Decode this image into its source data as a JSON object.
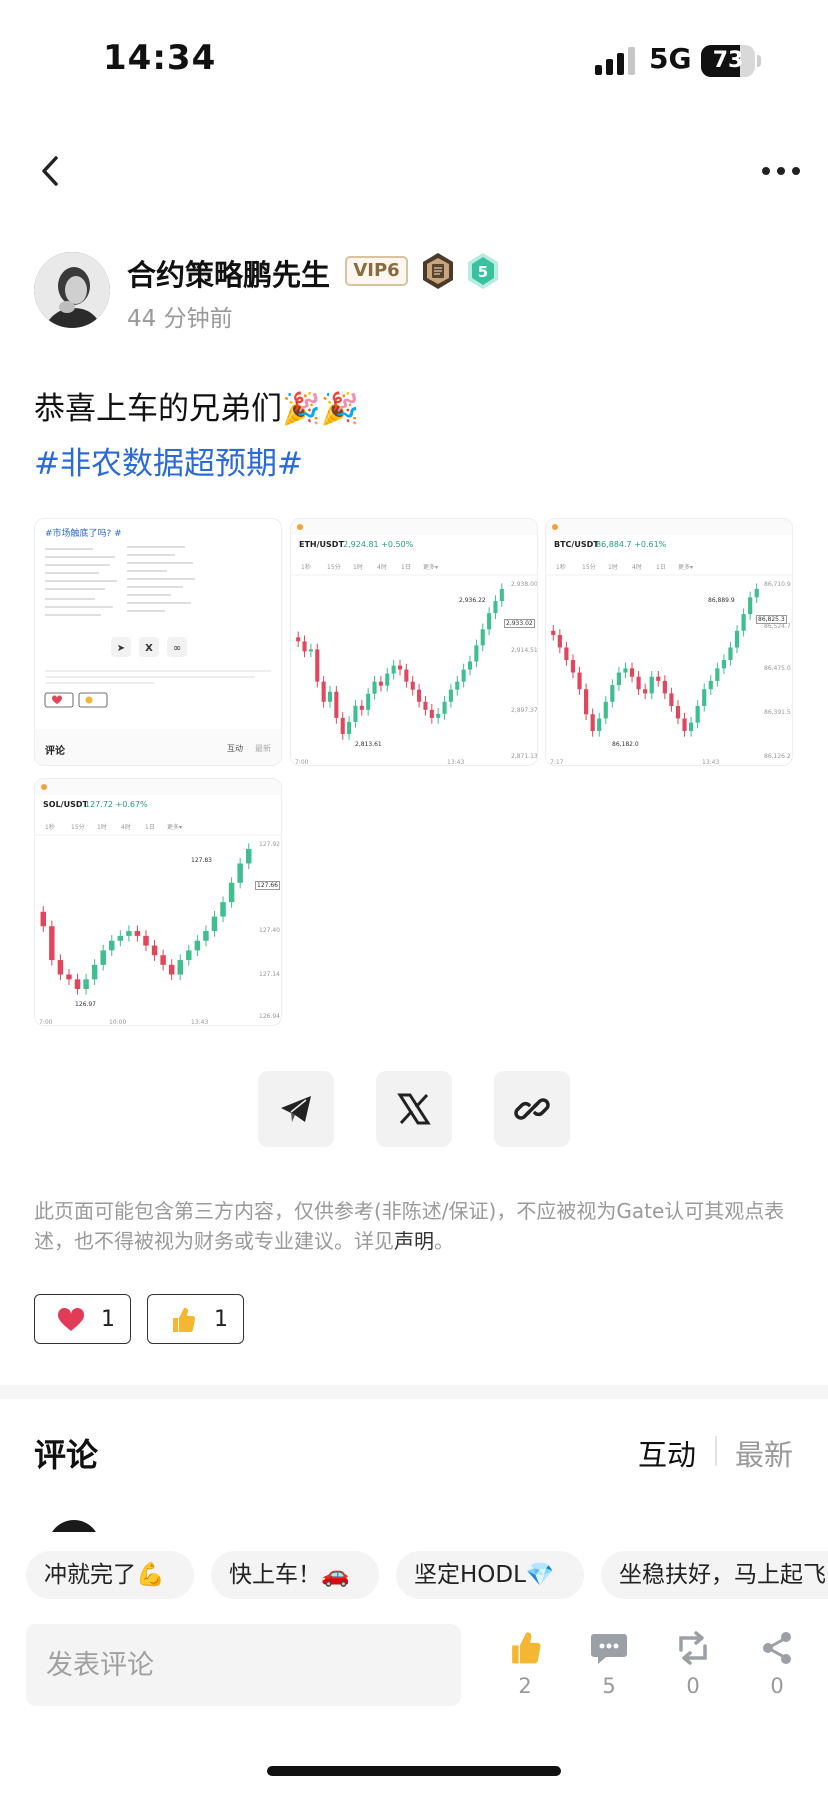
{
  "status_bar": {
    "time": "14:34",
    "network": "5G",
    "battery": "73",
    "battery_level": 0.73
  },
  "post": {
    "author": {
      "name": "合约策略鹏先生",
      "vip": "VIP6",
      "level": "5",
      "posted_ago": "44 分钟前"
    },
    "text": "恭喜上车的兄弟们🎉🎉",
    "hashtag": "#非农数据超预期#",
    "images": [
      {
        "kind": "post-screenshot",
        "tag": "#市场触底了吗? #",
        "comments_label": "评论",
        "tab_hot": "互动",
        "tab_new": "最新"
      },
      {
        "kind": "chart",
        "pair": "ETH/USDT",
        "price": "2,924.81 +0.50%",
        "timeframes": [
          "1秒",
          "15分",
          "1时",
          "4时",
          "1日",
          "更多▾"
        ],
        "high": "2,936.22",
        "low": "2,813.61",
        "last": "2,933.02",
        "axis": [
          "2,938.00",
          "2,914.51",
          "2,897.37",
          "2,871.13"
        ],
        "times": [
          "7:00",
          "13:43"
        ]
      },
      {
        "kind": "chart",
        "pair": "BTC/USDT",
        "price": "86,884.7 +0.61%",
        "timeframes": [
          "1秒",
          "15分",
          "1时",
          "4时",
          "1日",
          "更多▾"
        ],
        "high": "86,889.9",
        "low": "86,182.0",
        "last": "86,825.3",
        "axis": [
          "86,710.9",
          "86,524.7",
          "86,475.0",
          "86,391.5",
          "86,126.2"
        ],
        "times": [
          "7:17",
          "13:43"
        ]
      },
      {
        "kind": "chart",
        "pair": "SOL/USDT",
        "price": "127.72 +0.67%",
        "timeframes": [
          "1秒",
          "15分",
          "1时",
          "4时",
          "1日",
          "更多▾"
        ],
        "high": "127.83",
        "low": "126.97",
        "last": "127.66",
        "axis": [
          "127.92",
          "127.40",
          "127.14",
          "126.94"
        ],
        "times": [
          "7:00",
          "10:00",
          "13:43"
        ]
      }
    ],
    "share_buttons": [
      {
        "icon": "telegram-icon"
      },
      {
        "icon": "x-icon"
      },
      {
        "icon": "link-icon"
      }
    ],
    "disclaimer_text": "此页面可能包含第三方内容，仅供参考(非陈述/保证)，不应被视为Gate认可其观点表述，也不得被视为财务或专业建议。详见",
    "disclaimer_link": "声明",
    "disclaimer_end": "。",
    "reactions": [
      {
        "icon": "heart-icon",
        "count": "1"
      },
      {
        "icon": "thumbs-up-icon",
        "count": "1"
      }
    ]
  },
  "comments": {
    "title": "评论",
    "sort_hot": "互动",
    "sort_new": "最新"
  },
  "quick_replies": [
    "冲就完了💪",
    "快上车！🚗",
    "坚定HODL💎",
    "坐稳扶好，马上起飞"
  ],
  "footer": {
    "input_placeholder": "发表评论",
    "actions": [
      {
        "icon": "thumbs-up-icon",
        "count": "2"
      },
      {
        "icon": "comment-icon",
        "count": "5"
      },
      {
        "icon": "repost-icon",
        "count": "0"
      },
      {
        "icon": "share-icon",
        "count": "0"
      }
    ]
  },
  "colors": {
    "hashtag": "#2a6bd8",
    "up": "#3fbf8f",
    "down": "#e0475c"
  }
}
